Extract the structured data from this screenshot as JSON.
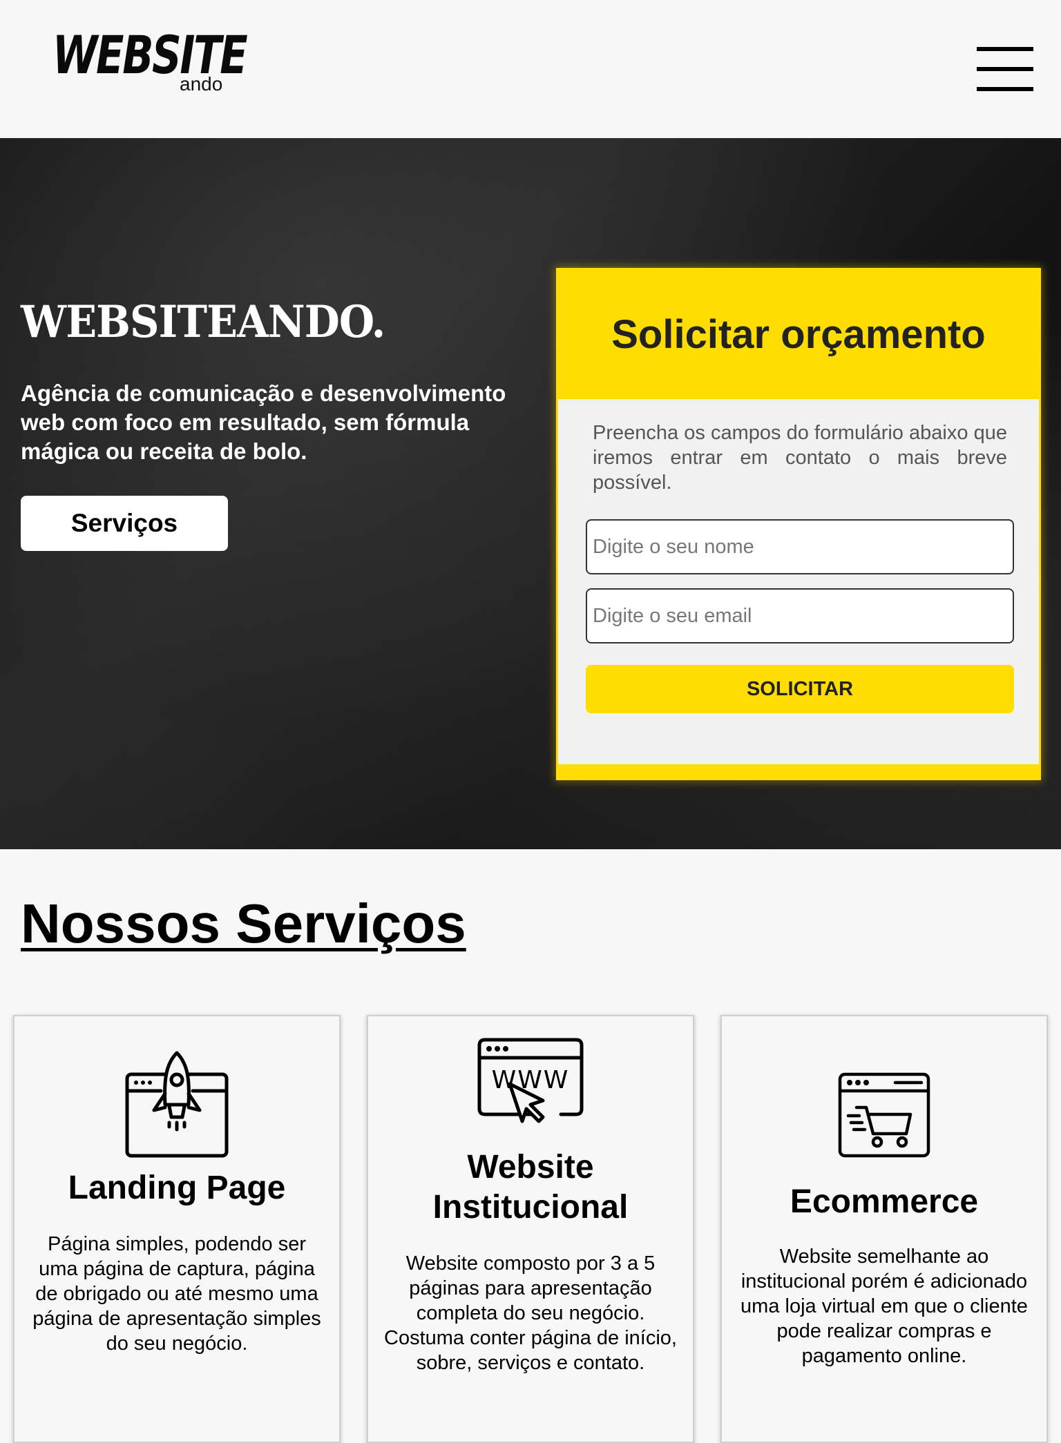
{
  "header": {
    "logo_main": "WEBSITE",
    "logo_sub": "ando",
    "menu_icon": "hamburger-menu-icon"
  },
  "hero": {
    "title": "WEBSITEANDO.",
    "description": "Agência de comunicação e desenvolvimento web com foco em resultado, sem fórmula mágica ou receita de bolo.",
    "button_label": "Serviços"
  },
  "quote_form": {
    "title": "Solicitar orçamento",
    "intro": "Preencha os campos do formulário abaixo que iremos entrar em contato o mais breve possível.",
    "name_placeholder": "Digite o seu nome",
    "email_placeholder": "Digite o seu email",
    "submit_label": "SOLICITAR",
    "accent_color": "#ffdd00"
  },
  "services": {
    "title": "Nossos Serviços",
    "items": [
      {
        "icon": "rocket-browser-icon",
        "title": "Landing Page",
        "text": "Página simples, podendo ser uma página de captura, página de obrigado ou até mesmo uma página de apresentação simples do seu negócio."
      },
      {
        "icon": "www-browser-icon",
        "title": "Website Institucional",
        "text": "Website composto por 3 a 5 páginas para apresentação completa do seu negócio. Costuma conter página de início, sobre, serviços e contato.",
        "icon_text": "WWW"
      },
      {
        "icon": "shopping-cart-browser-icon",
        "title": "Ecommerce",
        "text": "Website semelhante ao institucional porém é adicionado uma loja virtual em que o cliente pode realizar compras e pagamento online."
      }
    ]
  }
}
